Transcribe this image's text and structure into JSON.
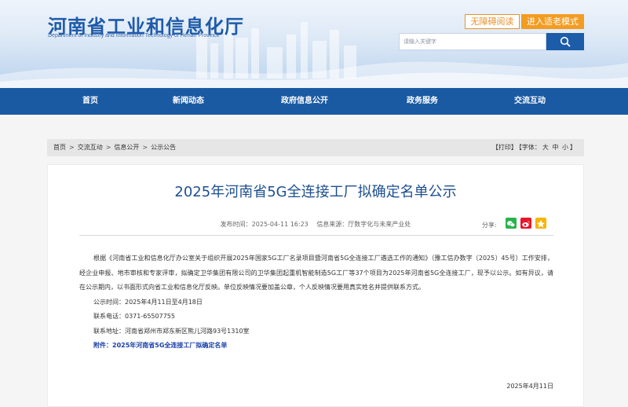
{
  "header": {
    "title": "河南省工业和信息化厅",
    "subtitle": "Department of Industry and Information Technology of Henan Province",
    "accessibility_label": "无障碍阅读",
    "elder_mode_label": "进入适老模式",
    "search_placeholder": "请输入关键字"
  },
  "nav": {
    "items": [
      {
        "label": "首页"
      },
      {
        "label": "新闻动态"
      },
      {
        "label": "政府信息公开"
      },
      {
        "label": "政务服务"
      },
      {
        "label": "交流互动"
      }
    ]
  },
  "breadcrumb": {
    "items": [
      "首页",
      "交流互动",
      "信息公开",
      "公示公告"
    ],
    "separator": ">"
  },
  "tools": {
    "print": "【打印】",
    "font_prefix": "【字体：",
    "large": "大",
    "medium": "中",
    "small": "小",
    "font_suffix": "】"
  },
  "article": {
    "title": "2025年河南省5G全连接工厂拟确定名单公示",
    "published": "发布时间：2025-04-11 16:23",
    "source": "信息来源：厅数字化与未来产业处",
    "share_label": "分享:",
    "paragraph": "根据《河南省工业和信息化厅办公室关于组织开展2025年国家5G工厂名录项目暨河南省5G全连接工厂遴选工作的通知》（豫工信办数字〔2025〕45号）工作安排，经企业申报、地市审核和专家评审，拟确定卫华集团有限公司的卫华集团起重机智能制造5G工厂等37个项目为2025年河南省5G全连接工厂，现予以公示。如有异议，请在公示期内，以书面形式向省工业和信息化厅反映。单位反映情况要加盖公章，个人反映情况要用真实姓名并提供联系方式。",
    "period": "公示时间：2025年4月11日至4月18日",
    "phone": "联系电话：0371-65507755",
    "address": "联系地址：河南省郑州市郑东新区熊儿河路93号1310室",
    "attachment": "附件：2025年河南省5G全连接工厂拟确定名单",
    "date": "2025年4月11日"
  },
  "colors": {
    "brand_blue": "#1a5aa3",
    "accent_orange": "#f39c22",
    "link_blue": "#1a3fa8"
  }
}
